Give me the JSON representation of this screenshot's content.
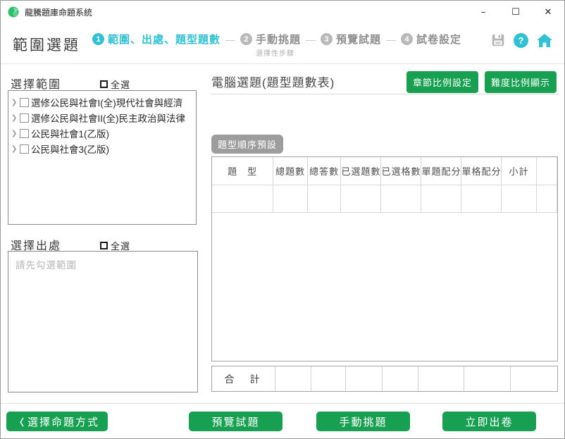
{
  "window": {
    "title": "龍騰題庫命題系統",
    "controls": {
      "minimize": "–",
      "maximize": "☐",
      "close": "✕"
    }
  },
  "header": {
    "page_title": "範圍選題",
    "step_separator": "—",
    "steps": [
      {
        "num": "1",
        "label": "範圍、出處、題型題數",
        "sub": ""
      },
      {
        "num": "2",
        "label": "手動挑題",
        "sub": "選擇性步驟"
      },
      {
        "num": "3",
        "label": "預覽試題",
        "sub": ""
      },
      {
        "num": "4",
        "label": "試卷設定",
        "sub": ""
      }
    ],
    "help_glyph": "?"
  },
  "left": {
    "range": {
      "title": "選擇範圍",
      "select_all": "全選",
      "expand_glyph": "❯",
      "items": [
        "選修公民與社會I(全)現代社會與經濟",
        "選修公民與社會II(全)民主政治與法律",
        "公民與社會1(乙版)",
        "公民與社會3(乙版)"
      ]
    },
    "source": {
      "title": "選擇出處",
      "select_all": "全選",
      "placeholder": "請先勾選範圍"
    }
  },
  "right": {
    "title": "電腦選題(題型題數表)",
    "chapter_ratio_btn": "章節比例設定",
    "difficulty_ratio_btn": "難度比例顯示",
    "preset_btn": "題型順序預設",
    "table": {
      "headers": [
        "題　型",
        "總題數",
        "總答數",
        "已選題數",
        "已選格數",
        "單題配分",
        "單格配分",
        "小計",
        ""
      ],
      "row": [
        "",
        "",
        "",
        "",
        "",
        "",
        "",
        "",
        ""
      ]
    },
    "total": {
      "label": "合　計",
      "cells": [
        "",
        "",
        "",
        "",
        "",
        "",
        ""
      ]
    }
  },
  "footer": {
    "back_chevron": "〈",
    "back": "選擇命題方式",
    "preview": "預覽試題",
    "manual": "手動挑題",
    "generate": "立即出卷"
  },
  "colors": {
    "accent_green": "#18a052",
    "accent_cyan": "#31c1d4",
    "inactive_gray": "#b9b9b9"
  }
}
